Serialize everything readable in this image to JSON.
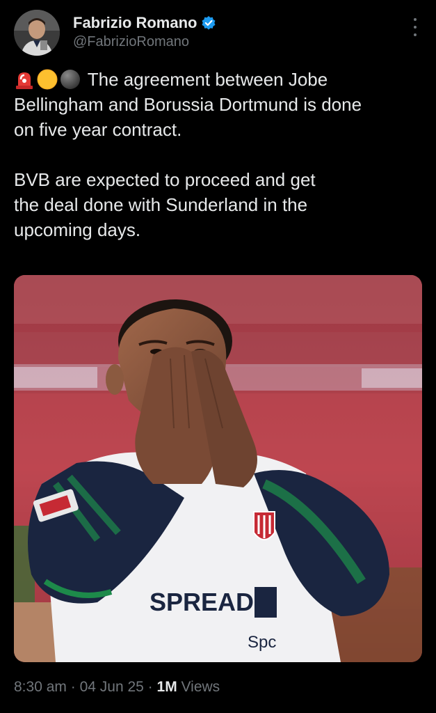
{
  "author": {
    "display_name": "Fabrizio Romano",
    "handle": "@FabrizioRomano",
    "verified": true,
    "verified_color": "#1d9bf0"
  },
  "tweet": {
    "emojis": [
      "rotating-light",
      "yellow-circle",
      "black-circle"
    ],
    "lines": [
      "The agreement between Jobe",
      "Bellingham and Borussia Dortmund is done",
      "on five year contract.",
      "",
      "BVB are expected to proceed and get",
      "the deal done with Sunderland in the",
      "upcoming days."
    ]
  },
  "media": {
    "shirt_sponsor": "SPREAD",
    "shirt_sponsor_2": "Spc"
  },
  "meta": {
    "time": "8:30 am",
    "separator": "·",
    "date": "04 Jun 25",
    "views_count": "1M",
    "views_label": "Views"
  },
  "colors": {
    "background": "#000000",
    "text": "#e7e9ea",
    "secondary": "#71767b"
  }
}
